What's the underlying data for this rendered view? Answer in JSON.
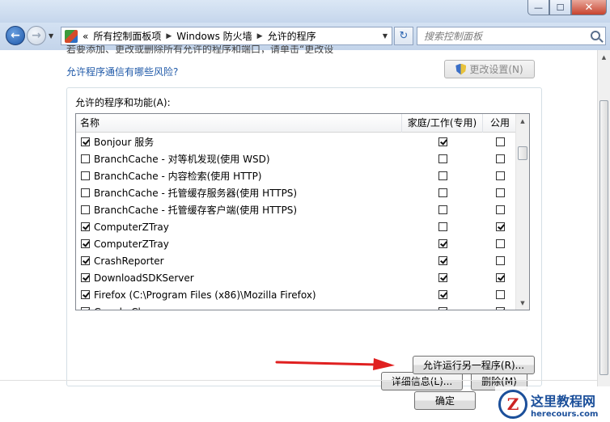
{
  "window": {
    "min_glyph": "—",
    "max_glyph": "☐",
    "close_glyph": "✕"
  },
  "nav": {
    "back_glyph": "←",
    "forward_glyph": "→",
    "breadcrumb_overflow": "«",
    "breadcrumbs": [
      "所有控制面板项",
      "Windows 防火墙",
      "允许的程序"
    ],
    "search_placeholder": "搜索控制面板",
    "refresh_glyph": "↻"
  },
  "content": {
    "clipped_text": "若要添加、更改或删除所有允许的程序和端口，请单击“更改设置”。",
    "risk_link": "允许程序通信有哪些风险?",
    "change_settings_label": "更改设置(N)",
    "group_label": "允许的程序和功能(A):",
    "columns": {
      "name": "名称",
      "home_work": "家庭/工作(专用)",
      "public": "公用"
    },
    "programs": [
      {
        "name": "Bonjour 服务",
        "enabled": true,
        "home": true,
        "public": false
      },
      {
        "name": "BranchCache - 对等机发现(使用 WSD)",
        "enabled": false,
        "home": false,
        "public": false
      },
      {
        "name": "BranchCache - 内容检索(使用 HTTP)",
        "enabled": false,
        "home": false,
        "public": false
      },
      {
        "name": "BranchCache - 托管缓存服务器(使用 HTTPS)",
        "enabled": false,
        "home": false,
        "public": false
      },
      {
        "name": "BranchCache - 托管缓存客户端(使用 HTTPS)",
        "enabled": false,
        "home": false,
        "public": false
      },
      {
        "name": "ComputerZTray",
        "enabled": true,
        "home": false,
        "public": true
      },
      {
        "name": "ComputerZTray",
        "enabled": true,
        "home": true,
        "public": false
      },
      {
        "name": "CrashReporter",
        "enabled": true,
        "home": true,
        "public": false
      },
      {
        "name": "DownloadSDKServer",
        "enabled": true,
        "home": true,
        "public": true
      },
      {
        "name": "Firefox (C:\\Program Files (x86)\\Mozilla Firefox)",
        "enabled": true,
        "home": true,
        "public": false
      },
      {
        "name": "Google Chrome",
        "enabled": true,
        "home": true,
        "public": true
      }
    ],
    "details_label": "详细信息(L)...",
    "delete_label": "删除(M)",
    "allow_another_label": "允许运行另一程序(R)...",
    "ok_label": "确定"
  },
  "watermark": {
    "logo_glyph": "Z",
    "cn": "这里教程网",
    "en": "herecours.com"
  },
  "colors": {
    "link": "#1f59a8",
    "arrow": "#e02020"
  }
}
